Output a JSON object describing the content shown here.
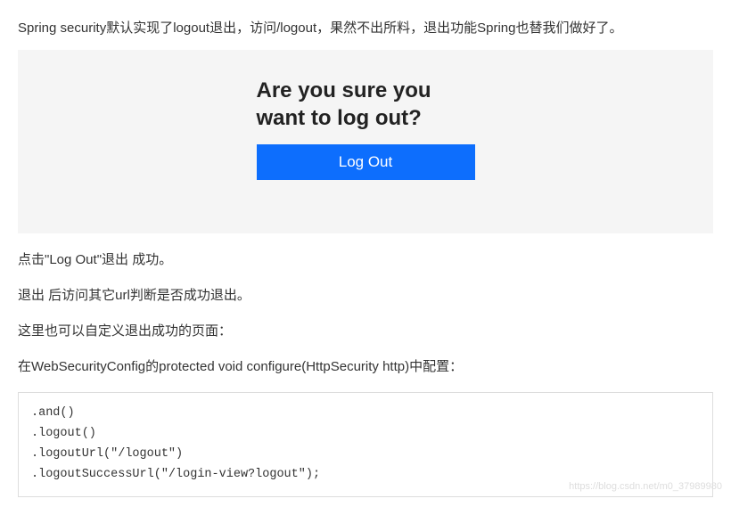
{
  "intro": "Spring security默认实现了logout退出，访问/logout，果然不出所料，退出功能Spring也替我们做好了。",
  "logout_panel": {
    "heading_line1": "Are you sure you",
    "heading_line2": "want to log out?",
    "button_label": "Log Out"
  },
  "paragraphs": {
    "p1": "点击\"Log Out\"退出 成功。",
    "p2": "退出 后访问其它url判断是否成功退出。",
    "p3": "这里也可以自定义退出成功的页面：",
    "p4": "在WebSecurityConfig的protected void configure(HttpSecurity http)中配置："
  },
  "code": ".and()\n.logout()\n.logoutUrl(\"/logout\")\n.logoutSuccessUrl(\"/login-view?logout\");",
  "watermark": "https://blog.csdn.net/m0_37989980"
}
